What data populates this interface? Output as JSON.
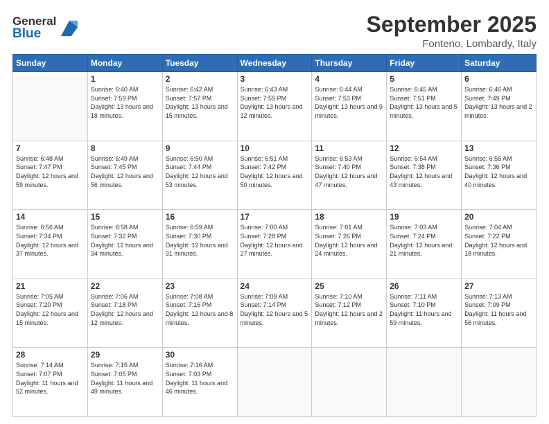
{
  "logo": {
    "general": "General",
    "blue": "Blue"
  },
  "title": "September 2025",
  "location": "Fonteno, Lombardy, Italy",
  "days_header": [
    "Sunday",
    "Monday",
    "Tuesday",
    "Wednesday",
    "Thursday",
    "Friday",
    "Saturday"
  ],
  "weeks": [
    [
      {
        "day": "",
        "sunrise": "",
        "sunset": "",
        "daylight": ""
      },
      {
        "day": "1",
        "sunrise": "Sunrise: 6:40 AM",
        "sunset": "Sunset: 7:59 PM",
        "daylight": "Daylight: 13 hours and 18 minutes."
      },
      {
        "day": "2",
        "sunrise": "Sunrise: 6:42 AM",
        "sunset": "Sunset: 7:57 PM",
        "daylight": "Daylight: 13 hours and 15 minutes."
      },
      {
        "day": "3",
        "sunrise": "Sunrise: 6:43 AM",
        "sunset": "Sunset: 7:55 PM",
        "daylight": "Daylight: 13 hours and 12 minutes."
      },
      {
        "day": "4",
        "sunrise": "Sunrise: 6:44 AM",
        "sunset": "Sunset: 7:53 PM",
        "daylight": "Daylight: 13 hours and 9 minutes."
      },
      {
        "day": "5",
        "sunrise": "Sunrise: 6:45 AM",
        "sunset": "Sunset: 7:51 PM",
        "daylight": "Daylight: 13 hours and 5 minutes."
      },
      {
        "day": "6",
        "sunrise": "Sunrise: 6:46 AM",
        "sunset": "Sunset: 7:49 PM",
        "daylight": "Daylight: 13 hours and 2 minutes."
      }
    ],
    [
      {
        "day": "7",
        "sunrise": "Sunrise: 6:48 AM",
        "sunset": "Sunset: 7:47 PM",
        "daylight": "Daylight: 12 hours and 59 minutes."
      },
      {
        "day": "8",
        "sunrise": "Sunrise: 6:49 AM",
        "sunset": "Sunset: 7:45 PM",
        "daylight": "Daylight: 12 hours and 56 minutes."
      },
      {
        "day": "9",
        "sunrise": "Sunrise: 6:50 AM",
        "sunset": "Sunset: 7:44 PM",
        "daylight": "Daylight: 12 hours and 53 minutes."
      },
      {
        "day": "10",
        "sunrise": "Sunrise: 6:51 AM",
        "sunset": "Sunset: 7:42 PM",
        "daylight": "Daylight: 12 hours and 50 minutes."
      },
      {
        "day": "11",
        "sunrise": "Sunrise: 6:53 AM",
        "sunset": "Sunset: 7:40 PM",
        "daylight": "Daylight: 12 hours and 47 minutes."
      },
      {
        "day": "12",
        "sunrise": "Sunrise: 6:54 AM",
        "sunset": "Sunset: 7:38 PM",
        "daylight": "Daylight: 12 hours and 43 minutes."
      },
      {
        "day": "13",
        "sunrise": "Sunrise: 6:55 AM",
        "sunset": "Sunset: 7:36 PM",
        "daylight": "Daylight: 12 hours and 40 minutes."
      }
    ],
    [
      {
        "day": "14",
        "sunrise": "Sunrise: 6:56 AM",
        "sunset": "Sunset: 7:34 PM",
        "daylight": "Daylight: 12 hours and 37 minutes."
      },
      {
        "day": "15",
        "sunrise": "Sunrise: 6:58 AM",
        "sunset": "Sunset: 7:32 PM",
        "daylight": "Daylight: 12 hours and 34 minutes."
      },
      {
        "day": "16",
        "sunrise": "Sunrise: 6:59 AM",
        "sunset": "Sunset: 7:30 PM",
        "daylight": "Daylight: 12 hours and 31 minutes."
      },
      {
        "day": "17",
        "sunrise": "Sunrise: 7:00 AM",
        "sunset": "Sunset: 7:28 PM",
        "daylight": "Daylight: 12 hours and 27 minutes."
      },
      {
        "day": "18",
        "sunrise": "Sunrise: 7:01 AM",
        "sunset": "Sunset: 7:26 PM",
        "daylight": "Daylight: 12 hours and 24 minutes."
      },
      {
        "day": "19",
        "sunrise": "Sunrise: 7:03 AM",
        "sunset": "Sunset: 7:24 PM",
        "daylight": "Daylight: 12 hours and 21 minutes."
      },
      {
        "day": "20",
        "sunrise": "Sunrise: 7:04 AM",
        "sunset": "Sunset: 7:22 PM",
        "daylight": "Daylight: 12 hours and 18 minutes."
      }
    ],
    [
      {
        "day": "21",
        "sunrise": "Sunrise: 7:05 AM",
        "sunset": "Sunset: 7:20 PM",
        "daylight": "Daylight: 12 hours and 15 minutes."
      },
      {
        "day": "22",
        "sunrise": "Sunrise: 7:06 AM",
        "sunset": "Sunset: 7:18 PM",
        "daylight": "Daylight: 12 hours and 12 minutes."
      },
      {
        "day": "23",
        "sunrise": "Sunrise: 7:08 AM",
        "sunset": "Sunset: 7:16 PM",
        "daylight": "Daylight: 12 hours and 8 minutes."
      },
      {
        "day": "24",
        "sunrise": "Sunrise: 7:09 AM",
        "sunset": "Sunset: 7:14 PM",
        "daylight": "Daylight: 12 hours and 5 minutes."
      },
      {
        "day": "25",
        "sunrise": "Sunrise: 7:10 AM",
        "sunset": "Sunset: 7:12 PM",
        "daylight": "Daylight: 12 hours and 2 minutes."
      },
      {
        "day": "26",
        "sunrise": "Sunrise: 7:11 AM",
        "sunset": "Sunset: 7:10 PM",
        "daylight": "Daylight: 11 hours and 59 minutes."
      },
      {
        "day": "27",
        "sunrise": "Sunrise: 7:13 AM",
        "sunset": "Sunset: 7:09 PM",
        "daylight": "Daylight: 11 hours and 56 minutes."
      }
    ],
    [
      {
        "day": "28",
        "sunrise": "Sunrise: 7:14 AM",
        "sunset": "Sunset: 7:07 PM",
        "daylight": "Daylight: 11 hours and 52 minutes."
      },
      {
        "day": "29",
        "sunrise": "Sunrise: 7:15 AM",
        "sunset": "Sunset: 7:05 PM",
        "daylight": "Daylight: 11 hours and 49 minutes."
      },
      {
        "day": "30",
        "sunrise": "Sunrise: 7:16 AM",
        "sunset": "Sunset: 7:03 PM",
        "daylight": "Daylight: 11 hours and 46 minutes."
      },
      {
        "day": "",
        "sunrise": "",
        "sunset": "",
        "daylight": ""
      },
      {
        "day": "",
        "sunrise": "",
        "sunset": "",
        "daylight": ""
      },
      {
        "day": "",
        "sunrise": "",
        "sunset": "",
        "daylight": ""
      },
      {
        "day": "",
        "sunrise": "",
        "sunset": "",
        "daylight": ""
      }
    ]
  ]
}
